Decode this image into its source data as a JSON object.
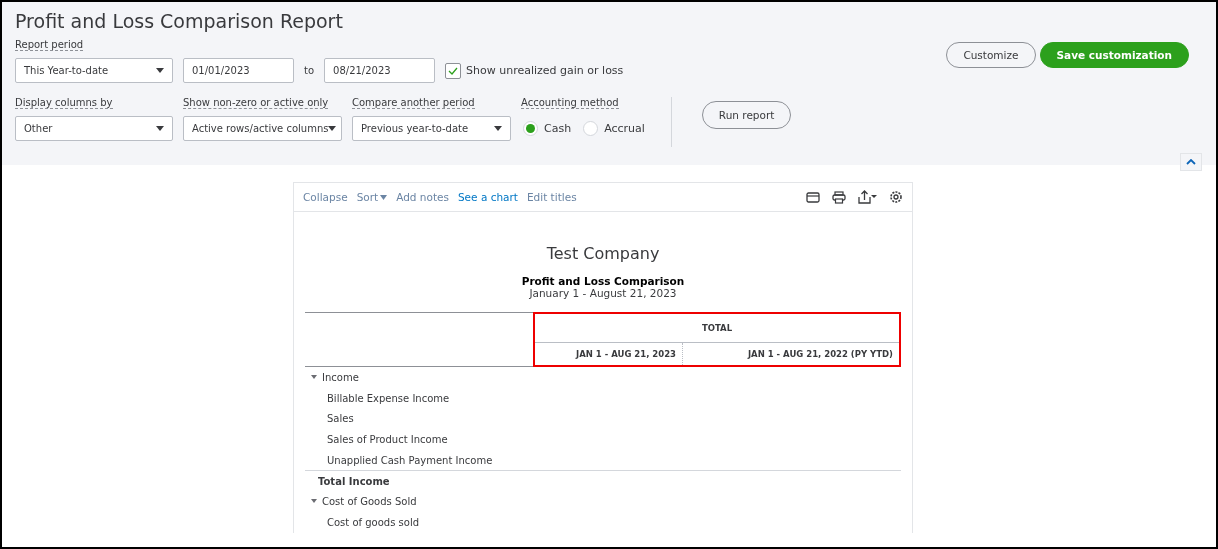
{
  "page_title": "Profit and Loss Comparison Report",
  "report_period": {
    "label": "Report period",
    "preset": "This Year-to-date",
    "from": "01/01/2023",
    "to_label": "to",
    "to": "08/21/2023"
  },
  "unrealized": {
    "label": "Show unrealized gain or loss",
    "checked": true
  },
  "filters": [
    {
      "label": "Display columns by",
      "value": "Other"
    },
    {
      "label": "Show non-zero or active only",
      "value": "Active rows/active columns"
    },
    {
      "label": "Compare another period",
      "value": "Previous year-to-date"
    }
  ],
  "accounting_method": {
    "label": "Accounting method",
    "options": [
      {
        "label": "Cash",
        "selected": true
      },
      {
        "label": "Accrual",
        "selected": false
      }
    ]
  },
  "run_button": "Run report",
  "customize_button": "Customize",
  "save_button": "Save customization",
  "panel_expanded": true,
  "report_toolbar": [
    {
      "label": "Collapse",
      "emphasized": false,
      "has_menu": false
    },
    {
      "label": "Sort",
      "emphasized": false,
      "has_menu": true
    },
    {
      "label": "Add notes",
      "emphasized": false,
      "has_menu": false
    },
    {
      "label": "See a chart",
      "emphasized": true,
      "has_menu": false
    },
    {
      "label": "Edit titles",
      "emphasized": false,
      "has_menu": false
    }
  ],
  "report": {
    "company": "Test Company",
    "title": "Profit and Loss Comparison",
    "period": "January 1 - August 21, 2023",
    "header_highlighted": true,
    "group_header": "TOTAL",
    "columns": [
      "JAN 1 - AUG 21, 2023",
      "JAN 1 - AUG 21, 2022 (PY YTD)"
    ],
    "rows": [
      {
        "kind": "group",
        "label": "Income",
        "expanded": true
      },
      {
        "kind": "item",
        "label": "Billable Expense Income"
      },
      {
        "kind": "item",
        "label": "Sales"
      },
      {
        "kind": "item",
        "label": "Sales of Product Income"
      },
      {
        "kind": "item",
        "label": "Unapplied Cash Payment Income"
      },
      {
        "kind": "total",
        "label": "Total Income"
      },
      {
        "kind": "group",
        "label": "Cost of Goods Sold",
        "expanded": true
      },
      {
        "kind": "item",
        "label": "Cost of goods sold"
      }
    ]
  }
}
